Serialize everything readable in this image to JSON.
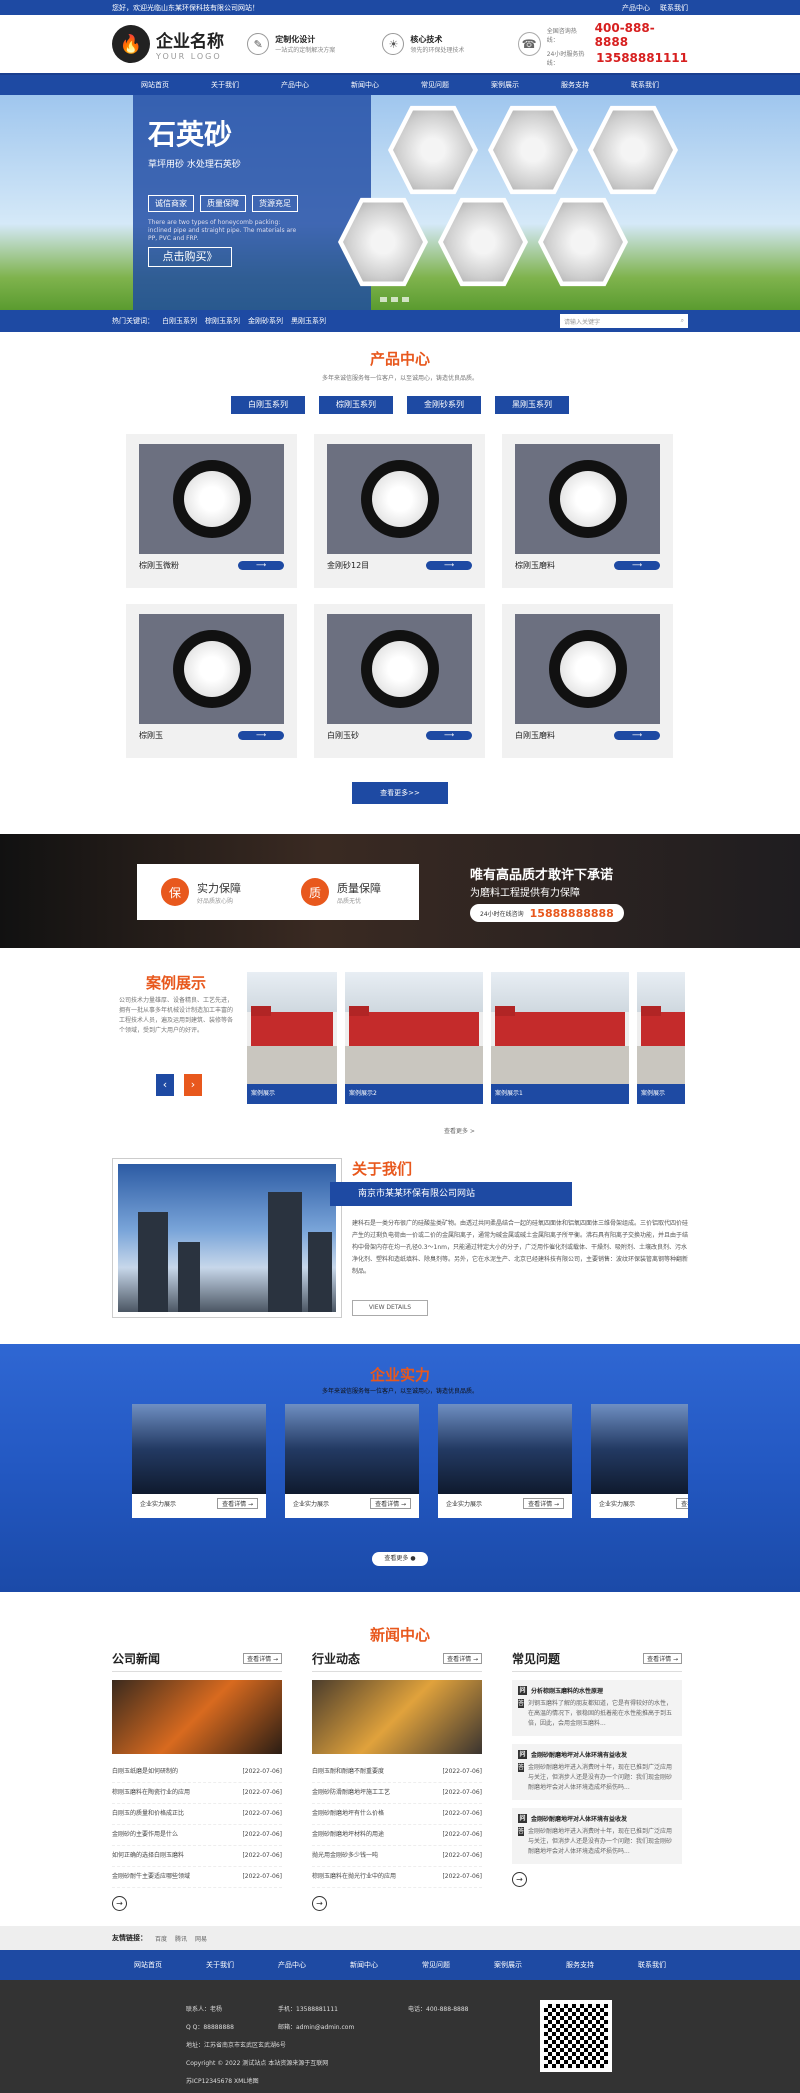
{
  "topbar": {
    "welcome": "您好，欢迎光临山东某环保科技有限公司网站！",
    "product_center": "产品中心",
    "contact": "联系我们"
  },
  "header": {
    "logo_name": "企业名称",
    "logo_sub": "YOUR LOGO",
    "feature1_title": "定制化设计",
    "feature1_sub": "一站式的定制解决方案",
    "feature2_title": "核心技术",
    "feature2_sub": "领先的环保处理技术",
    "hotline_label": "全国咨询热线：",
    "hotline_phone": "400-888-8888",
    "mobile_label": "24小时服务热线：",
    "mobile_phone": "13588881111"
  },
  "nav": [
    "网站首页",
    "关于我们",
    "产品中心",
    "新闻中心",
    "常见问题",
    "案例展示",
    "服务支持",
    "联系我们"
  ],
  "banner": {
    "title": "石英砂",
    "subtitle": "草坪用砂 水处理石英砂",
    "tags": [
      "诚信商家",
      "质量保障",
      "货源充足"
    ],
    "desc": "There are two types of honeycomb packing: inclined pipe and straight pipe. The materials are PP, PVC and FRP.",
    "button": "点击购买》"
  },
  "searchbar": {
    "label": "热门关键词：",
    "keywords": [
      "白刚玉系列",
      "棕刚玉系列",
      "金刚砂系列",
      "黑刚玉系列"
    ],
    "placeholder": "请输入关键字"
  },
  "products": {
    "title": "产品中心",
    "subtitle": "多年来诚信服务每一位客户，以至诚用心，铸造优良品质。",
    "categories": [
      "白刚玉系列",
      "棕刚玉系列",
      "金刚砂系列",
      "黑刚玉系列"
    ],
    "items": [
      {
        "name": "棕刚玉微粉"
      },
      {
        "name": "金刚砂12目"
      },
      {
        "name": "棕刚玉磨料"
      },
      {
        "name": "棕刚玉"
      },
      {
        "name": "白刚玉砂"
      },
      {
        "name": "白刚玉磨料"
      }
    ],
    "arrow": "⟶",
    "more": "查看更多>>"
  },
  "promise": {
    "item1_title": "实力保障",
    "item1_sub": "好品质放心购",
    "item2_title": "质量保障",
    "item2_sub": "品质无忧",
    "headline": "唯有高品质才敢许下承诺",
    "subline": "为磨料工程提供有力保障",
    "pill_label": "24小时在线咨询",
    "pill_phone": "15888888888"
  },
  "cases": {
    "title": "案例展示",
    "text": "公司技术力量雄厚、设备精良、工艺先进，拥有一批从事多年机械设计制造加工丰富的工程技术人员，遍及运用到建筑、装修等各个领域，受到广大用户的好评。",
    "items": [
      "案例展示",
      "案例展示2",
      "案例展示1",
      "案例展示"
    ],
    "view_more": "查看更多 >"
  },
  "about": {
    "title": "关于我们",
    "company": "南京市某某环保有限公司网站",
    "text": "建科石是一类分布很广的硅酸盐类矿物。由透过共同柔晶结合一起的硅氧四面体和铝氧四面体三维骨架组成。三价铝取代四价硅产生的过剩负电荷由一价或二价的金属阳离子，通常为碱金属或碱土金属阳离子所平衡。沸石具有阳离子交换功能，并且由于结构中骨架内存在均一孔径0.3～1nm，只能通过特定大小的分子，广泛用作催化剂或载体、干燥剂、吸附剂、土壤改良剂、污水净化剂、塑料和造纸填料、除臭剂等。另外，它在水泥生产、北京已经建科技有限公司，主要销售：波纹环保装管离钢等种翻新制品。",
    "view_details": "VIEW DETAILS"
  },
  "strength": {
    "title": "企业实力",
    "subtitle": "多年来诚信服务每一位客户，以至诚用心，铸造优良品质。",
    "items": [
      {
        "name": "企业实力展示",
        "btn": "查看详情 →"
      },
      {
        "name": "企业实力展示",
        "btn": "查看详情 →"
      },
      {
        "name": "企业实力展示",
        "btn": "查看详情 →"
      },
      {
        "name": "企业实力展示",
        "btn": "查看详情 →"
      }
    ],
    "view_more": "查看更多 ●"
  },
  "news": {
    "title": "新闻中心",
    "col1": {
      "name": "公司新闻",
      "more": "查看详情 →",
      "items": [
        {
          "t": "白刚玉纸磨是如何研制的",
          "d": "[2022-07-06]"
        },
        {
          "t": "棕刚玉磨料在陶瓷行业的应用",
          "d": "[2022-07-06]"
        },
        {
          "t": "白刚玉的质量和价格成正比",
          "d": "[2022-07-06]"
        },
        {
          "t": "金刚砂的主要作用是什么",
          "d": "[2022-07-06]"
        },
        {
          "t": "如何正确的选择白刚玉磨料",
          "d": "[2022-07-06]"
        },
        {
          "t": "金刚砂耐牛主要适应哪些领域",
          "d": "[2022-07-06]"
        }
      ]
    },
    "col2": {
      "name": "行业动态",
      "more": "查看详情 →",
      "items": [
        {
          "t": "白刚玉耐和耐磨不耐重要度",
          "d": "[2022-07-06]"
        },
        {
          "t": "金刚砂防滑耐磨地坪施工工艺",
          "d": "[2022-07-06]"
        },
        {
          "t": "金刚砂耐磨地坪有什么价格",
          "d": "[2022-07-06]"
        },
        {
          "t": "金刚砂耐磨地坪材料的用途",
          "d": "[2022-07-06]"
        },
        {
          "t": "抛光用金刚砂多少钱一吨",
          "d": "[2022-07-06]"
        },
        {
          "t": "棕刚玉磨料在抛光行业中的应用",
          "d": "[2022-07-06]"
        }
      ]
    },
    "col3": {
      "name": "常见问题",
      "more": "查看详情 →",
      "items": [
        {
          "q": "分析棕刚玉磨料的水性原理",
          "a": "刘钢玉磨料了解的朋友都知道，它是有得较好的水性，在高温的情况下，很稳固的抵着能在水性能推高于到五倍，因此，会用金刚玉磨料..."
        },
        {
          "q": "金刚砂耐磨地坪对人体环境有益收发",
          "a": "金刚砂耐磨地坪进入消费时十年，现在已推到广泛应用与关注，但消步人还是没有办一个问题：我们现金刚砂耐磨地坪会对人体环境造成坏损伤吗..."
        },
        {
          "q": "金刚砂耐磨地坪对人体环境有益收发",
          "a": "金刚砂耐磨地坪进入消费时十年，现在已推到广泛应用与关注，但消步人还是没有办一个问题：我们现金刚砂耐磨地坪会对人体环境造成坏损伤吗..."
        }
      ]
    },
    "circle": "→"
  },
  "links": {
    "label": "友情链接：",
    "items": [
      "百度",
      "腾讯",
      "网易"
    ]
  },
  "footer_nav": [
    "网站首页",
    "关于我们",
    "产品中心",
    "新闻中心",
    "常见问题",
    "案例展示",
    "服务支持",
    "联系我们"
  ],
  "footer": {
    "contact": "联系人：老杨",
    "phone": "手机：13588881111",
    "tel": "电话：400-888-8888",
    "qq": "Q Q：88888888",
    "email": "邮箱：admin@admin.com",
    "address": "地址：江苏省南京市玄武区玄武湖6号",
    "copyright": "Copyright © 2022 测试站点 本站资源来源于互联网",
    "icp": "苏ICP12345678 XML地图"
  }
}
